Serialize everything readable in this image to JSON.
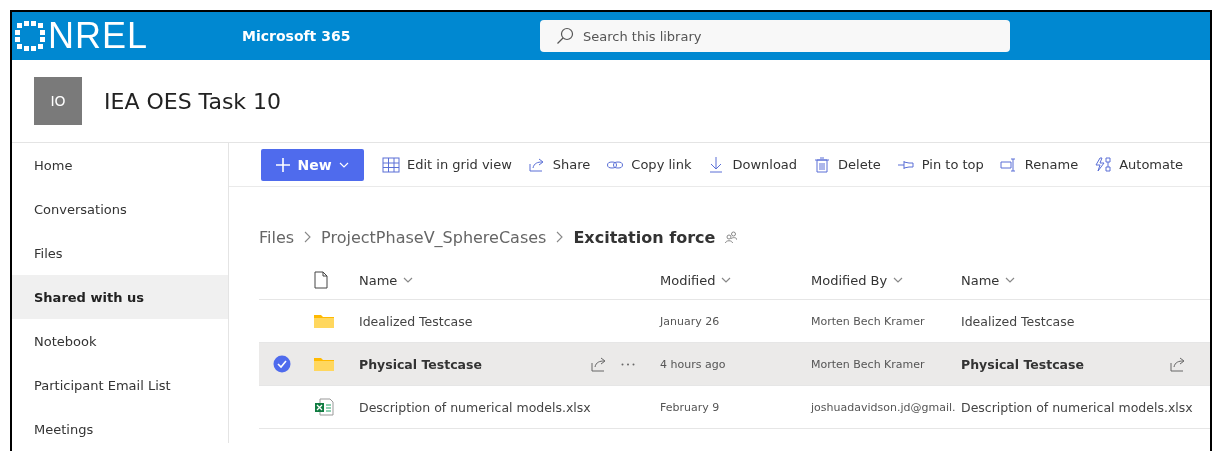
{
  "top_bar": {
    "logo": "NREL",
    "app": "Microsoft 365",
    "search": {
      "placeholder": "Search this library"
    }
  },
  "site": {
    "avatar": "IO",
    "title": "IEA OES Task 10"
  },
  "sidebar": {
    "items": [
      {
        "label": "Home",
        "selected": false
      },
      {
        "label": "Conversations",
        "selected": false
      },
      {
        "label": "Files",
        "selected": false
      },
      {
        "label": "Shared with us",
        "selected": true
      },
      {
        "label": "Notebook",
        "selected": false
      },
      {
        "label": "Participant Email List",
        "selected": false
      },
      {
        "label": "Meetings",
        "selected": false
      }
    ]
  },
  "command_bar": {
    "new_button": "New",
    "commands": [
      {
        "kind": "grid",
        "label": "Edit in grid view"
      },
      {
        "kind": "share",
        "label": "Share"
      },
      {
        "kind": "link",
        "label": "Copy link"
      },
      {
        "kind": "download",
        "label": "Download"
      },
      {
        "kind": "delete",
        "label": "Delete"
      },
      {
        "kind": "pin",
        "label": "Pin to top"
      },
      {
        "kind": "rename",
        "label": "Rename"
      },
      {
        "kind": "automate",
        "label": "Automate"
      }
    ]
  },
  "breadcrumb": [
    "Files",
    "ProjectPhaseV_SphereCases",
    "Excitation force"
  ],
  "table": {
    "columns": [
      "Name",
      "Modified",
      "Modified By",
      "Name"
    ],
    "rows": [
      {
        "kind": "folder",
        "selected": false,
        "name": "Idealized Testcase",
        "modified": "January 26",
        "modified_by": "Morten Bech Kramer",
        "name_2": "Idealized Testcase"
      },
      {
        "kind": "folder",
        "selected": true,
        "name": "Physical Testcase",
        "modified": "4 hours ago",
        "modified_by": "Morten Bech Kramer",
        "name_2": "Physical Testcase"
      },
      {
        "kind": "excel",
        "selected": false,
        "name": "Description of numerical models.xlsx",
        "modified": "February 9",
        "modified_by": "joshuadavidson.jd@gmail.",
        "name_2": "Description of numerical models.xlsx"
      }
    ]
  }
}
